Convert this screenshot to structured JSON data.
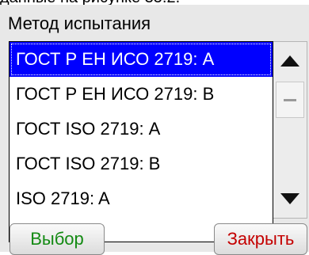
{
  "window": {
    "title": "Метод испытания"
  },
  "methods": [
    "ГОСТ Р ЕН ИСО 2719: А",
    "ГОСТ Р ЕН ИСО 2719: В",
    "ГОСТ ISO 2719: А",
    "ГОСТ ISO 2719: В",
    "ISO 2719: A"
  ],
  "selected_index": 0,
  "buttons": {
    "select": "Выбор",
    "close": "Закрыть"
  },
  "icons": {
    "scroll_up": "triangle-up",
    "scroll_down": "triangle-down",
    "thumb": "grip"
  },
  "colors": {
    "selection": "#0000ff",
    "select_text": "#138a13",
    "close_text": "#c40000"
  }
}
